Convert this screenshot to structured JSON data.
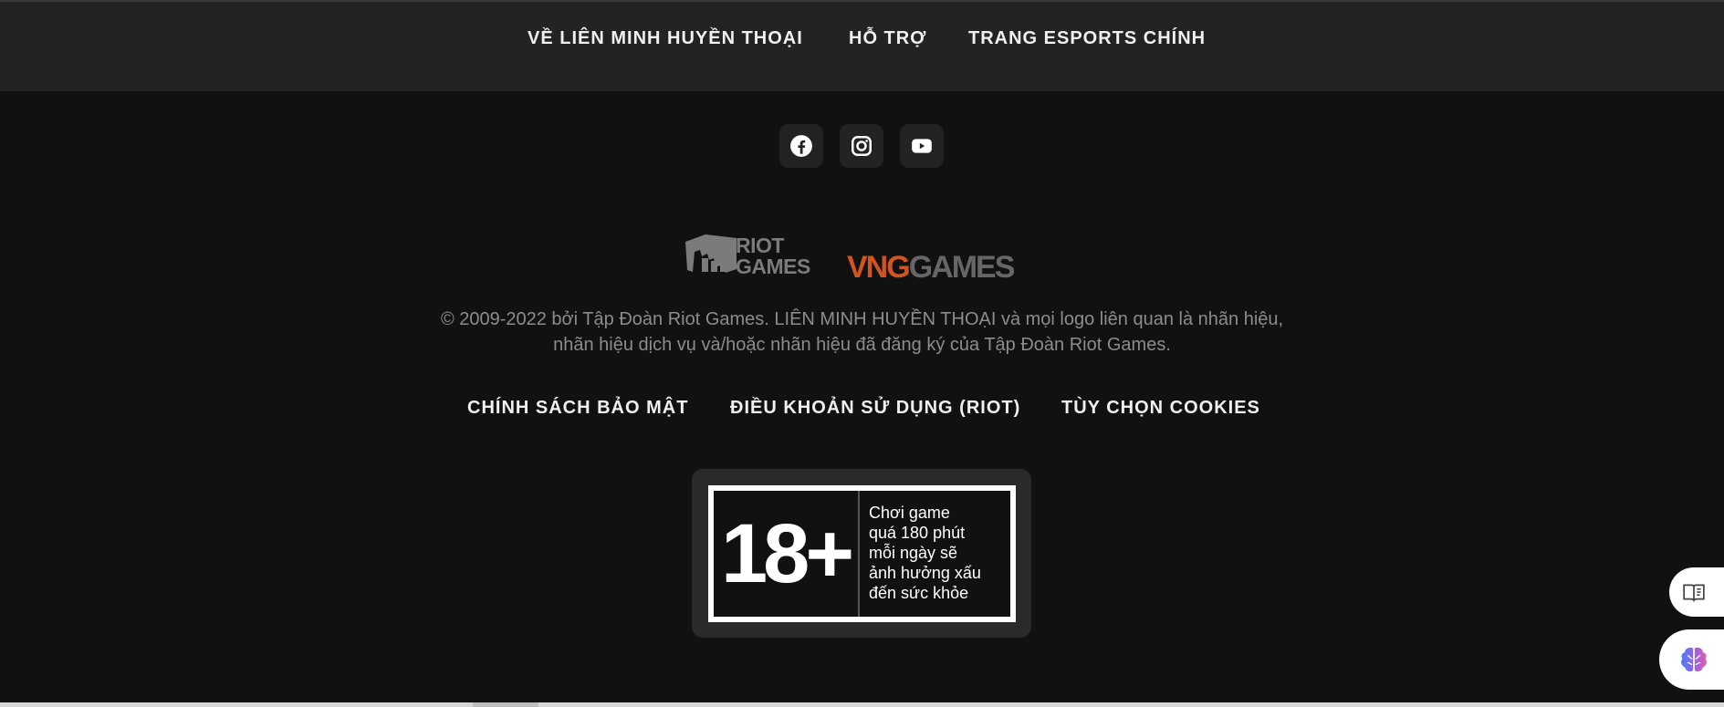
{
  "header": {
    "nav": [
      "VỀ LIÊN MINH HUYỀN THOẠI",
      "HỖ TRỢ",
      "TRANG ESPORTS CHÍNH"
    ]
  },
  "social": [
    {
      "name": "facebook",
      "icon": "facebook-icon"
    },
    {
      "name": "instagram",
      "icon": "instagram-icon"
    },
    {
      "name": "youtube",
      "icon": "youtube-icon"
    }
  ],
  "brands": {
    "riot_line1": "RIOT",
    "riot_line2": "GAMES",
    "vng_part1": "VNG",
    "vng_part2": "GAMES"
  },
  "copyright": {
    "line1": "© 2009-2022 bởi Tập Đoàn Riot Games. LIÊN MINH HUYỀN THOẠI và mọi logo liên quan là nhãn hiệu,",
    "line2": "nhãn hiệu dịch vụ và/hoặc nhãn hiệu đã đăng ký của Tập Đoàn Riot Games."
  },
  "legal": [
    "CHÍNH SÁCH BẢO MẬT",
    "ĐIỀU KHOẢN SỬ DỤNG (RIOT)",
    "TÙY CHỌN COOKIES"
  ],
  "rating": {
    "age": "18+",
    "warning_lines": [
      "Chơi game",
      "quá 180 phút",
      "mỗi ngày sẽ",
      "ảnh hưởng xấu",
      "đến sức khỏe"
    ]
  },
  "colors": {
    "background": "#111111",
    "nav_background": "#232323",
    "vng_orange": "#d2541f"
  }
}
